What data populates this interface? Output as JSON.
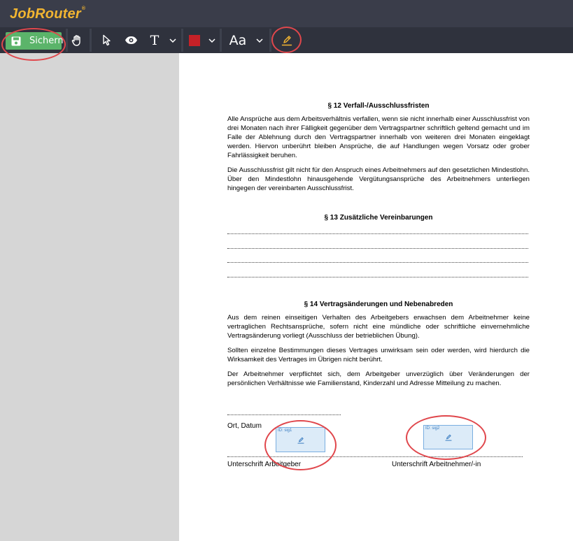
{
  "app": {
    "logo_text": "JobRouter",
    "logo_mark": "®"
  },
  "toolbar": {
    "save_label": "Sichern",
    "text_tool_label": "T",
    "font_label": "Aa",
    "chevron": "⌄",
    "color_swatch": "#c62127"
  },
  "document": {
    "section12": {
      "heading": "§ 12 Verfall-/Ausschlussfristen",
      "p1": "Alle Ansprüche aus dem Arbeitsverhältnis verfallen, wenn sie nicht innerhalb einer Ausschlussfrist von drei Monaten nach ihrer Fälligkeit gegenüber dem Vertragspartner schriftlich geltend gemacht und im Falle der Ablehnung durch den Vertragspartner innerhalb von weiteren drei Monaten eingeklagt werden. Hiervon unberührt bleiben Ansprüche, die auf Handlungen wegen Vorsatz oder grober Fahrlässigkeit beruhen.",
      "p2": "Die Ausschlussfrist gilt nicht für den Anspruch eines Arbeitnehmers auf den gesetzlichen Mindestlohn. Über den Mindestlohn hinausgehende Vergütungsansprüche des Arbeitnehmers unterliegen hingegen der vereinbarten Ausschlussfrist."
    },
    "section13": {
      "heading": "§ 13 Zusätzliche Vereinbarungen"
    },
    "section14": {
      "heading": "§ 14 Vertragsänderungen und Nebenabreden",
      "p1": "Aus dem reinen einseitigen Verhalten des Arbeitgebers erwachsen dem Arbeitnehmer keine vertraglichen Rechtsansprüche, sofern nicht eine mündliche oder schriftliche einvernehmliche Vertragsänderung vorliegt (Ausschluss der betrieblichen Übung).",
      "p2": "Sollten einzelne Bestimmungen dieses Vertrages unwirksam sein oder werden, wird hierdurch die Wirksamkeit des Vertrages im Übrigen nicht berührt.",
      "p3": "Der Arbeitnehmer verpflichtet sich, dem Arbeitgeber unverzüglich über Veränderungen der persönlichen Verhältnisse wie Familienstand, Kinderzahl und Adresse Mitteilung zu machen."
    },
    "place_date_label": "Ort, Datum",
    "employer_sig_label": "Unterschrift Arbeitgeber",
    "employee_sig_label": "Unterschrift Arbeitnehmer/-in",
    "sig1_id": "ID: sig1",
    "sig2_id": "ID: sig2"
  },
  "colors": {
    "topbar": "#3a3d4a",
    "toolbar": "#2f323d",
    "save_green": "#5bb46a",
    "logo": "#f2b531",
    "annotation_ring": "#e0474c",
    "sig_field": "#dcebf8"
  },
  "icons": [
    "save-icon",
    "hand-icon",
    "pointer-icon",
    "eye-icon",
    "text-icon",
    "color-swatch",
    "font-size-icon",
    "signature-pen-icon"
  ]
}
